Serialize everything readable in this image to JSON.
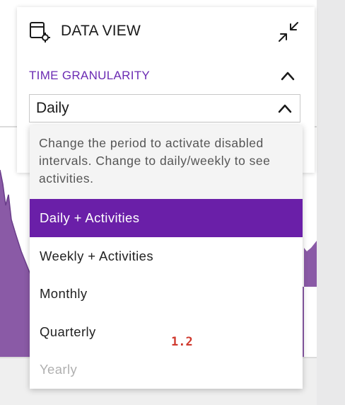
{
  "card": {
    "title": "DATA VIEW",
    "icons": {
      "title": "calendar-settings-icon",
      "collapse": "collapse-arrows-icon"
    }
  },
  "time_granularity": {
    "label": "TIME GRANULARITY",
    "selected_value": "Daily",
    "help_text": "Change the period to activate disabled intervals. Change to daily/weekly to see activities.",
    "options": [
      {
        "label": "Daily + Activities",
        "state": "selected"
      },
      {
        "label": "Weekly + Activities",
        "state": "enabled"
      },
      {
        "label": "Monthly",
        "state": "enabled"
      },
      {
        "label": "Quarterly",
        "state": "enabled"
      },
      {
        "label": "Yearly",
        "state": "disabled"
      }
    ]
  },
  "annotation": "1.2",
  "colors": {
    "accent": "#6a1fa8",
    "section_label": "#6b2bb3",
    "chart_fill": "#8a5aa6",
    "annotation": "#d03a2f"
  }
}
